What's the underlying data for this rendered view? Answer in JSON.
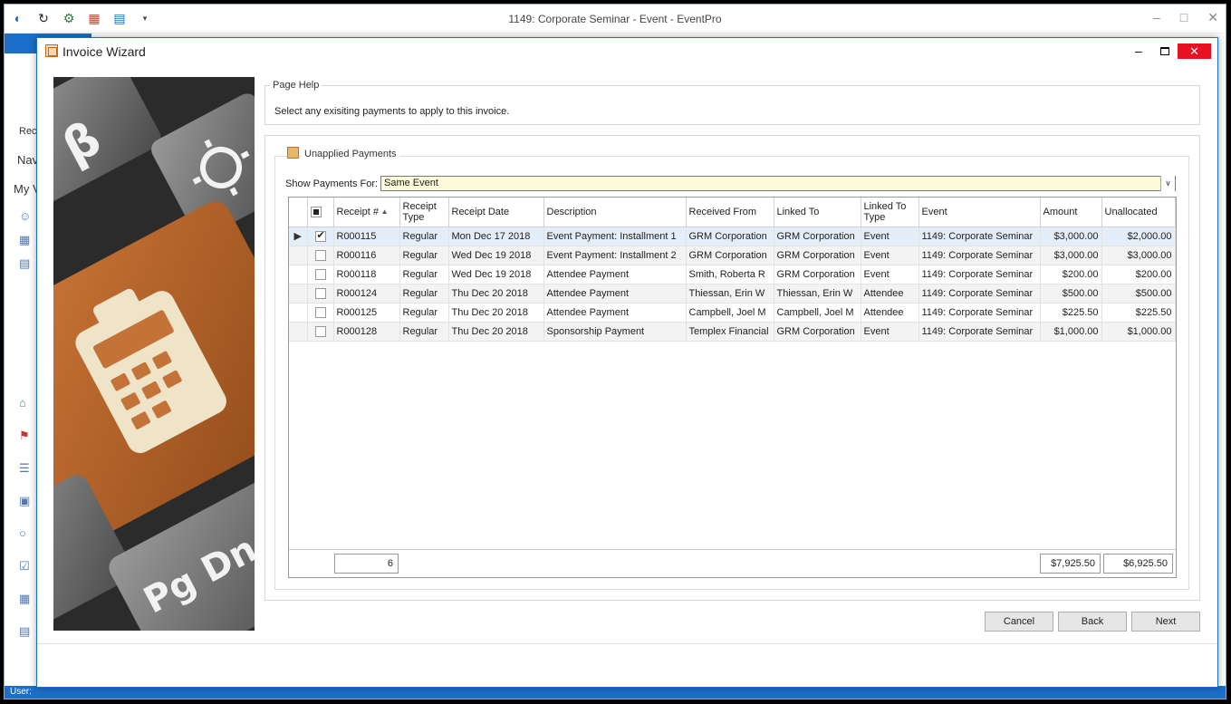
{
  "app": {
    "title": "1149: Corporate Seminar - Event - EventPro",
    "left_texts": [
      "Rec",
      "Nav",
      "My V"
    ],
    "status_text": "User:"
  },
  "dialog": {
    "title": "Invoice Wizard",
    "close_label": "✕"
  },
  "page_help": {
    "label": "Page Help",
    "text": "Select any exisiting payments to apply to this invoice."
  },
  "payments": {
    "label": "Unapplied Payments",
    "show_label": "Show Payments For:",
    "show_value": "Same Event",
    "columns": [
      "Receipt #",
      "Receipt Type",
      "Receipt Date",
      "Description",
      "Received From",
      "Linked To",
      "Linked To Type",
      "Event",
      "Amount",
      "Unallocated"
    ],
    "rows": [
      {
        "checked": true,
        "receipt": "R000115",
        "type": "Regular",
        "date": "Mon Dec 17 2018",
        "description": "Event Payment: Installment 1",
        "received_from": "GRM Corporation",
        "linked_to": "GRM Corporation",
        "linked_type": "Event",
        "event": "1149: Corporate Seminar",
        "amount": "$3,000.00",
        "unallocated": "$2,000.00"
      },
      {
        "checked": false,
        "receipt": "R000116",
        "type": "Regular",
        "date": "Wed Dec 19 2018",
        "description": "Event Payment: Installment 2",
        "received_from": "GRM Corporation",
        "linked_to": "GRM Corporation",
        "linked_type": "Event",
        "event": "1149: Corporate Seminar",
        "amount": "$3,000.00",
        "unallocated": "$3,000.00"
      },
      {
        "checked": false,
        "receipt": "R000118",
        "type": "Regular",
        "date": "Wed Dec 19 2018",
        "description": "Attendee Payment",
        "received_from": "Smith, Roberta R",
        "linked_to": "GRM Corporation",
        "linked_type": "Event",
        "event": "1149: Corporate Seminar",
        "amount": "$200.00",
        "unallocated": "$200.00"
      },
      {
        "checked": false,
        "receipt": "R000124",
        "type": "Regular",
        "date": "Thu Dec 20 2018",
        "description": "Attendee Payment",
        "received_from": "Thiessan, Erin W",
        "linked_to": "Thiessan, Erin W",
        "linked_type": "Attendee",
        "event": "1149: Corporate Seminar",
        "amount": "$500.00",
        "unallocated": "$500.00"
      },
      {
        "checked": false,
        "receipt": "R000125",
        "type": "Regular",
        "date": "Thu Dec 20 2018",
        "description": "Attendee Payment",
        "received_from": "Campbell, Joel M",
        "linked_to": "Campbell, Joel M",
        "linked_type": "Attendee",
        "event": "1149: Corporate Seminar",
        "amount": "$225.50",
        "unallocated": "$225.50"
      },
      {
        "checked": false,
        "receipt": "R000128",
        "type": "Regular",
        "date": "Thu Dec 20 2018",
        "description": "Sponsorship Payment",
        "received_from": "Templex Financial",
        "linked_to": "GRM Corporation",
        "linked_type": "Event",
        "event": "1149: Corporate Seminar",
        "amount": "$1,000.00",
        "unallocated": "$1,000.00"
      }
    ],
    "footer": {
      "count": "6",
      "amount_total": "$7,925.50",
      "unallocated_total": "$6,925.50"
    }
  },
  "buttons": {
    "cancel": "Cancel",
    "back": "Back",
    "next": "Next"
  },
  "image_keys": [
    "Pg Dn",
    "β"
  ],
  "colors": {
    "accent": "#1c6fc8",
    "close": "#e81123",
    "select_bg": "#fbfbd9",
    "key_orange": "#c0672a"
  }
}
